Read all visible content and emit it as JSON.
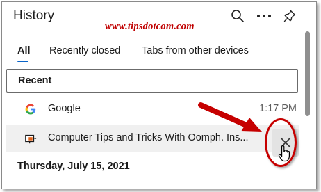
{
  "panel": {
    "title": "History",
    "header_icons": [
      "search-icon",
      "more-options-icon",
      "pin-icon"
    ]
  },
  "watermark": "www.tipsdotcom.com",
  "tabs": [
    {
      "label": "All",
      "active": true
    },
    {
      "label": "Recently closed",
      "active": false
    },
    {
      "label": "Tabs from other devices",
      "active": false
    }
  ],
  "recent_section": {
    "label": "Recent"
  },
  "history_items": [
    {
      "title": "Google",
      "time": "1:17 PM",
      "icon": "google-icon"
    },
    {
      "title": "Computer Tips and Tricks With Oomph. Ins...",
      "icon": "site-favicon-icon",
      "hovered": true
    }
  ],
  "date_heading": "Thursday, July 15, 2021",
  "colors": {
    "accent": "#0a64c8",
    "annotation_red": "#c60000",
    "watermark_red": "#c00000",
    "hover_row": "#f0f0f0",
    "scrollbar": "#8f8f8f"
  }
}
